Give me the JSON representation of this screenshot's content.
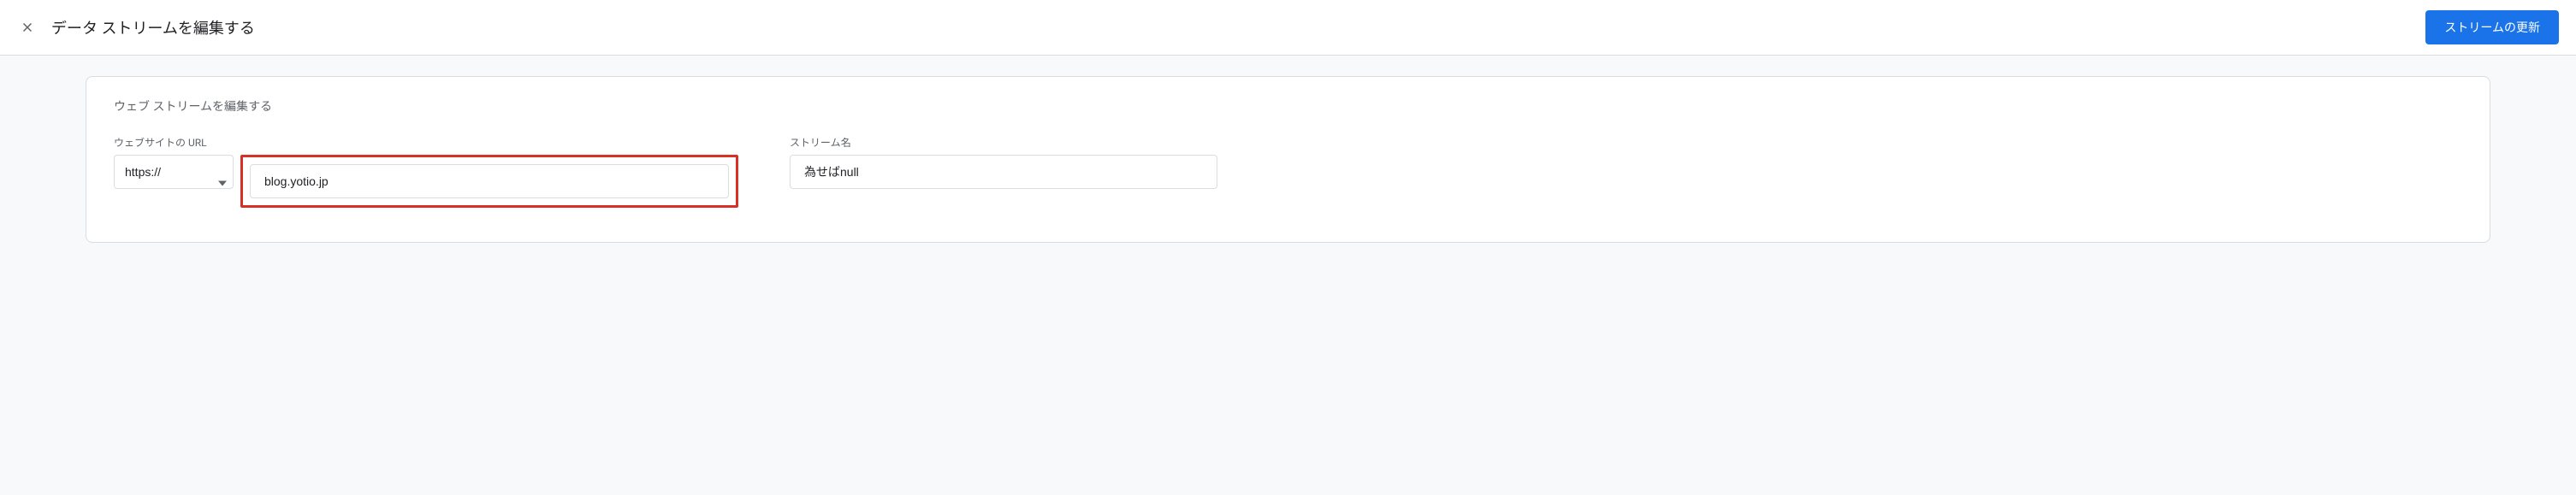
{
  "header": {
    "title": "データ ストリームを編集する",
    "update_button_label": "ストリームの更新"
  },
  "card": {
    "title": "ウェブ ストリームを編集する",
    "url": {
      "label": "ウェブサイトの URL",
      "protocol_selected": "https://",
      "domain_value": "blog.yotio.jp"
    },
    "stream_name": {
      "label": "ストリーム名",
      "value": "為せばnull"
    }
  }
}
